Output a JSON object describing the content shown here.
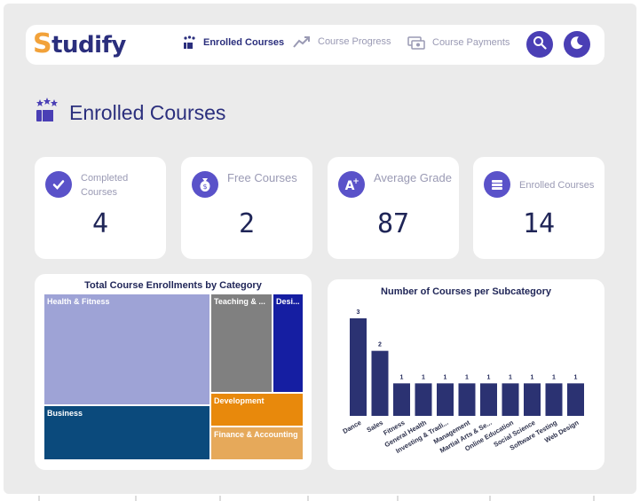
{
  "app": {
    "name_first": "S",
    "name_rest": "tudify"
  },
  "nav": [
    {
      "label": "Enrolled Courses",
      "icon": "award-stars-icon",
      "active": true
    },
    {
      "label": "Course Progress",
      "icon": "trend-up-icon",
      "active": false
    },
    {
      "label": "Course Payments",
      "icon": "payments-icon",
      "active": false
    }
  ],
  "buttons": {
    "search": "search-icon",
    "theme": "moon-icon"
  },
  "page": {
    "title": "Enrolled Courses"
  },
  "cards": [
    {
      "label": "Completed Courses",
      "value": "4",
      "icon": "check-circle-icon"
    },
    {
      "label": "Free Courses",
      "value": "2",
      "icon": "money-bag-icon"
    },
    {
      "label": "Average Grade",
      "value": "87",
      "icon": "grade-a-plus-icon"
    },
    {
      "label": "Enrolled Courses",
      "value": "14",
      "icon": "books-stack-icon"
    }
  ],
  "colors": {
    "accent": "#4a3fb5",
    "navy": "#2b2f7d",
    "bar": "#2b3272"
  },
  "chart_data": [
    {
      "type": "treemap",
      "title": "Total Course Enrollments by Category",
      "categories": [
        "Health & Fitness",
        "Business",
        "Teaching & ...",
        "Desi...",
        "Development",
        "Finance & Accounting"
      ],
      "colors": [
        "#9ea3d6",
        "#0b4a7c",
        "#808080",
        "#151ea2",
        "#e8890c",
        "#e6a95a"
      ]
    },
    {
      "type": "bar",
      "title": "Number of Courses per Subcategory",
      "categories": [
        "Dance",
        "Sales",
        "Fitness",
        "General Health",
        "Investing & Tradi...",
        "Management",
        "Martial Arts & Se...",
        "Online Education",
        "Social Science",
        "Software Testing",
        "Web Design"
      ],
      "values": [
        3,
        2,
        1,
        1,
        1,
        1,
        1,
        1,
        1,
        1,
        1
      ],
      "ylim": [
        0,
        3
      ]
    }
  ]
}
